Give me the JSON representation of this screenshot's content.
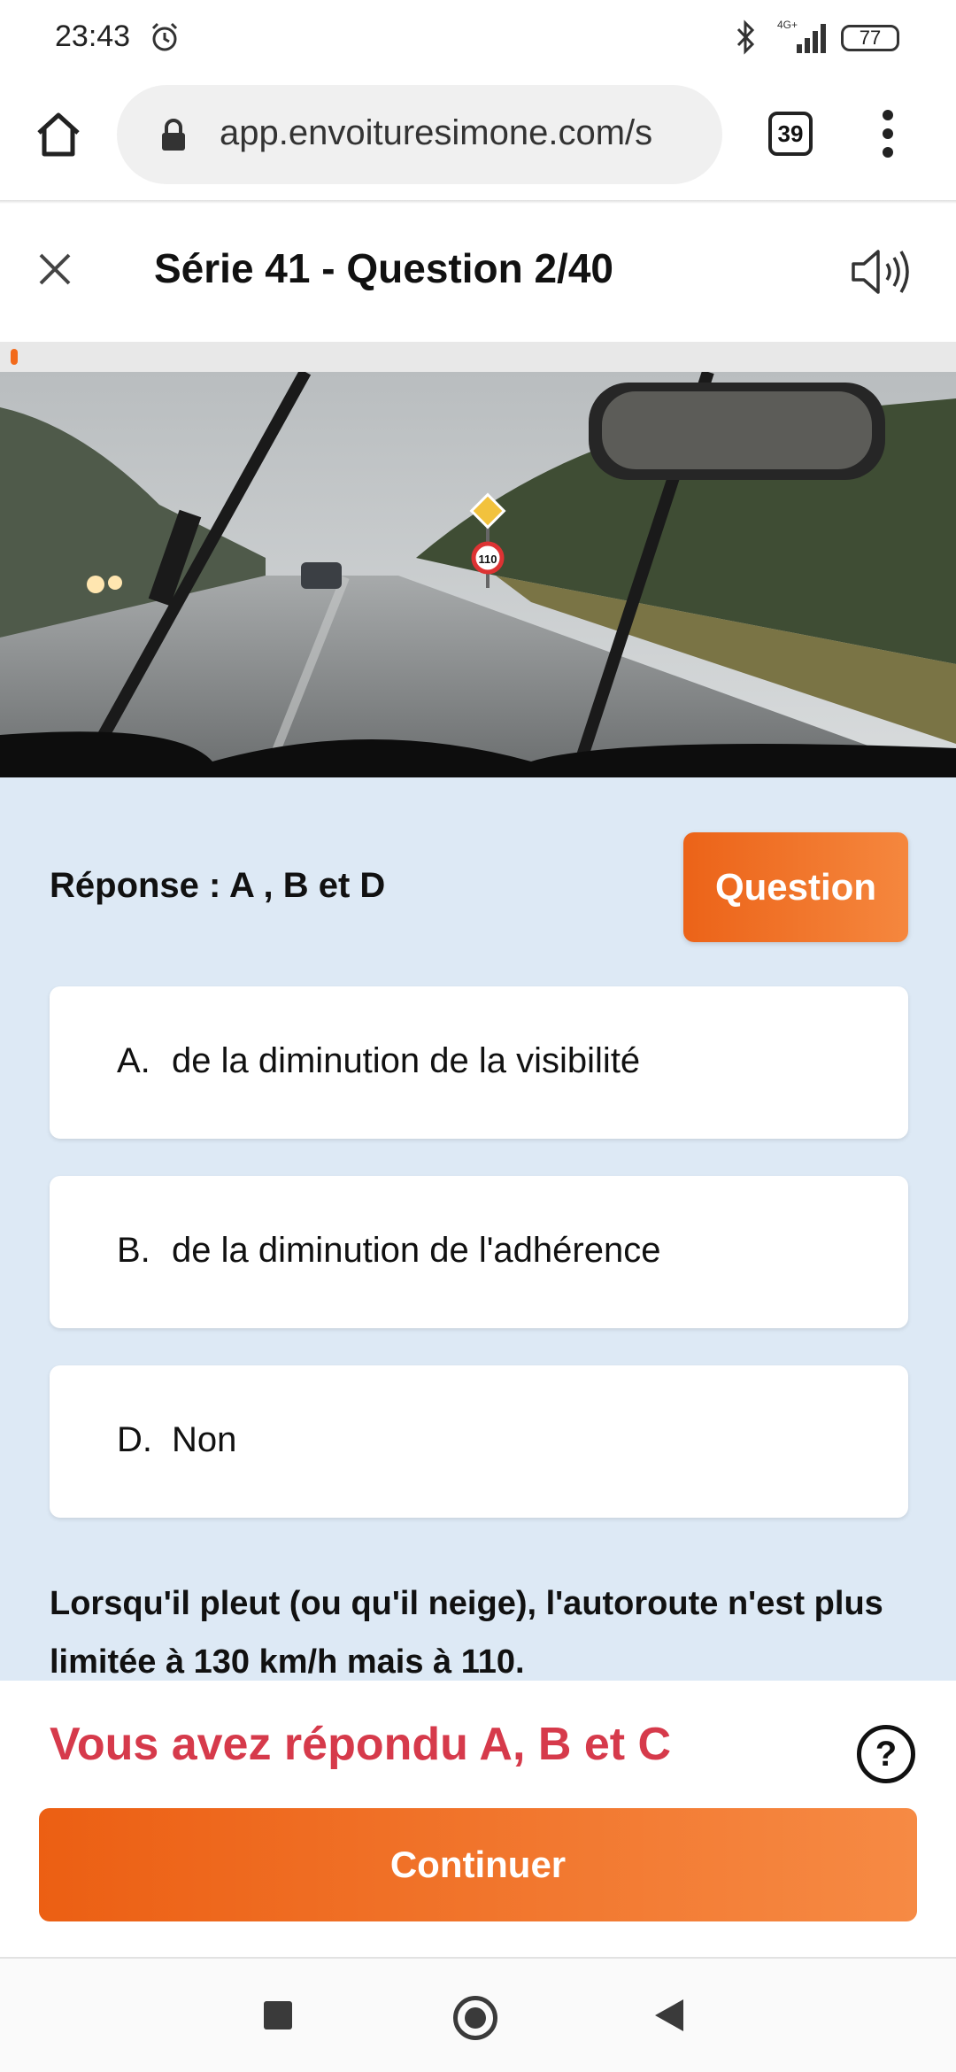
{
  "status_bar": {
    "time": "23:43",
    "network": "4G+",
    "battery": "77",
    "icons": [
      "alarm-icon",
      "bluetooth-icon",
      "signal-icon",
      "battery-icon"
    ]
  },
  "browser": {
    "url": "app.envoituresimone.com/s",
    "tab_count": "39",
    "icons": [
      "home-icon",
      "lock-icon",
      "more-vert-icon"
    ]
  },
  "header": {
    "title": "Série 41 - Question 2/40",
    "icons": [
      "close-icon",
      "speaker-icon"
    ]
  },
  "progress": {
    "current": 2,
    "total": 40
  },
  "scene": {
    "sign_speed": "110"
  },
  "answer": {
    "label": "Réponse : A , B et D",
    "question_button": "Question"
  },
  "choices": [
    {
      "letter": "A.",
      "text": "de la diminution de la visibilité"
    },
    {
      "letter": "B.",
      "text": "de la diminution de l'adhérence"
    },
    {
      "letter": "D.",
      "text": "Non"
    }
  ],
  "explanation": "Lorsqu'il pleut (ou qu'il neige), l'autoroute n'est plus limitée à 130 km/h mais à 110.",
  "result": {
    "text": "Vous avez répondu A, B et C",
    "help": "?",
    "continue": "Continuer"
  },
  "colors": {
    "accent": "#f26a1b",
    "error": "#d63a4b",
    "content_bg": "#dde9f5"
  }
}
